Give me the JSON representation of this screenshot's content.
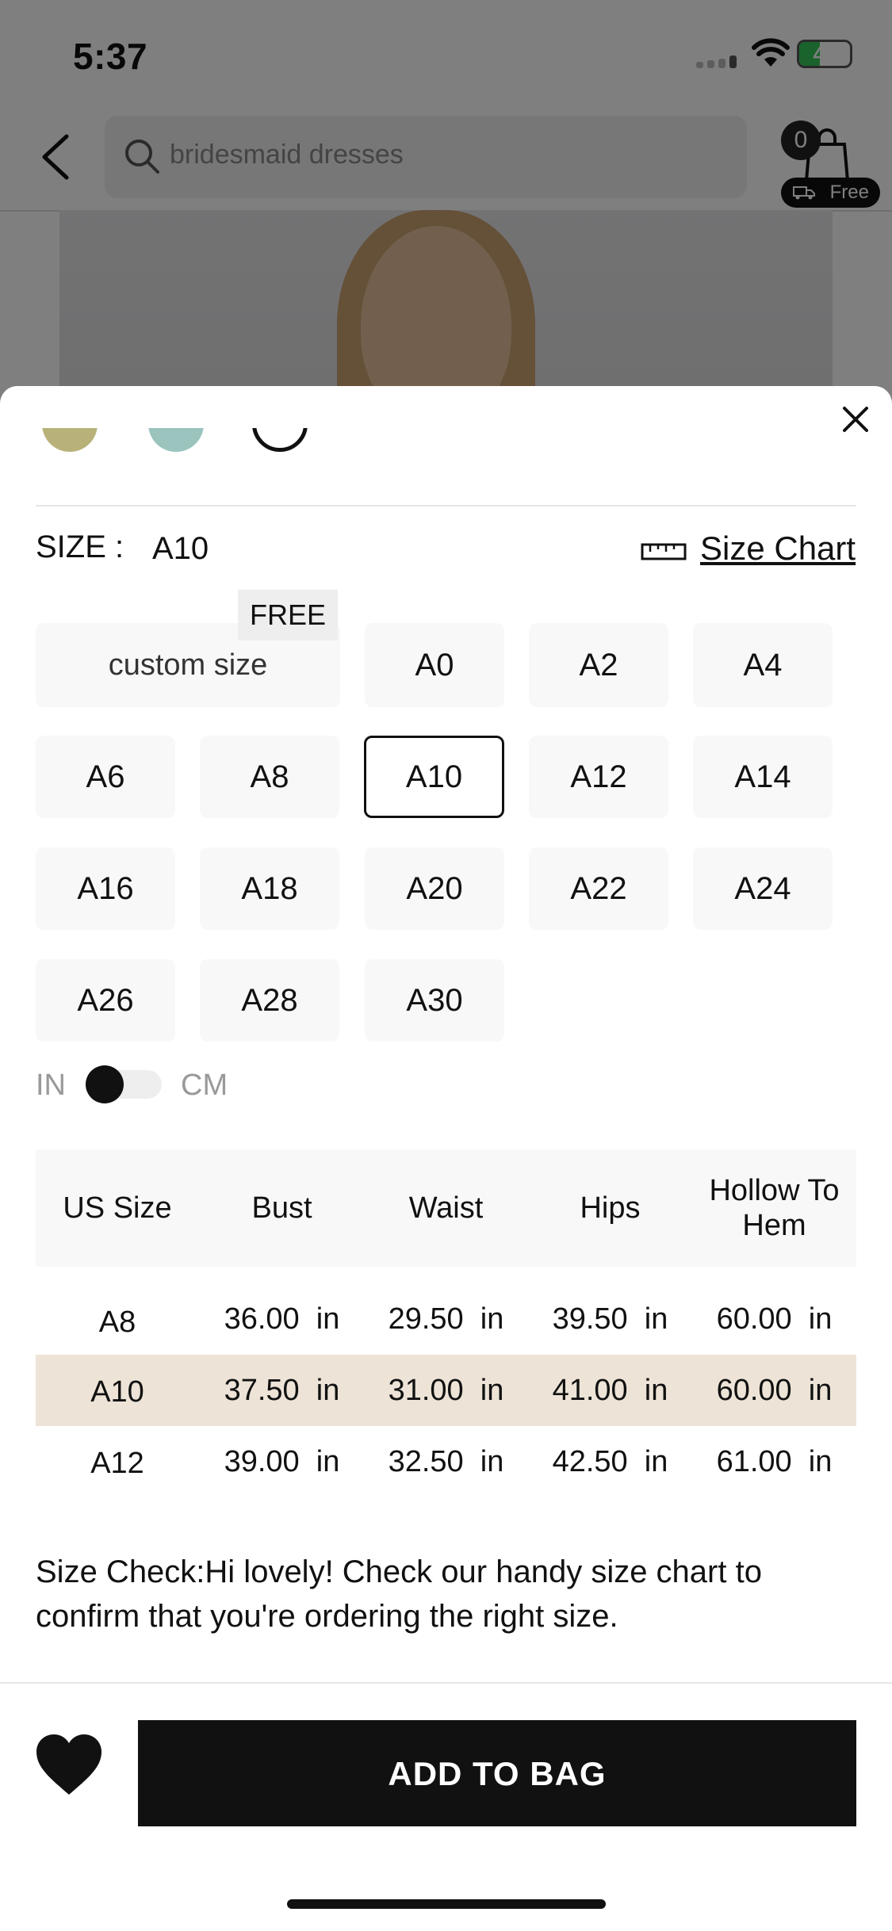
{
  "status_bar": {
    "time": "5:37",
    "battery": "41"
  },
  "nav": {
    "search_placeholder": "bridesmaid dresses",
    "bag_count": "0",
    "free_label": "Free"
  },
  "size_section": {
    "label": "SIZE :",
    "selected": "A10",
    "size_chart_link": "Size Chart",
    "free_badge": "FREE",
    "custom_size": "custom size",
    "sizes": [
      "A0",
      "A2",
      "A4",
      "A6",
      "A8",
      "A10",
      "A12",
      "A14",
      "A16",
      "A18",
      "A20",
      "A22",
      "A24",
      "A26",
      "A28",
      "A30"
    ]
  },
  "units": {
    "in": "IN",
    "cm": "CM",
    "selected": "IN"
  },
  "table": {
    "headers": [
      "US Size",
      "Bust",
      "Waist",
      "Hips",
      "Hollow To Hem"
    ],
    "rows": [
      [
        "A8",
        "36.00  in",
        "29.50  in",
        "39.50  in",
        "60.00  in"
      ],
      [
        "A10",
        "37.50  in",
        "31.00  in",
        "41.00  in",
        "60.00  in"
      ],
      [
        "A12",
        "39.00  in",
        "32.50  in",
        "42.50  in",
        "61.00  in"
      ]
    ],
    "highlight_row": 1
  },
  "size_check": "Size Check:Hi lovely! Check our handy size chart to confirm that you're ordering the right size.",
  "cta": {
    "add_to_bag": "ADD TO BAG"
  },
  "colors": {
    "accent": "#111111",
    "highlight_row": "#ede3d7",
    "battery": "#34c759"
  },
  "icons": [
    "back-arrow-icon",
    "search-icon",
    "shopping-bag-icon",
    "truck-icon",
    "close-icon",
    "ruler-icon",
    "heart-icon"
  ]
}
